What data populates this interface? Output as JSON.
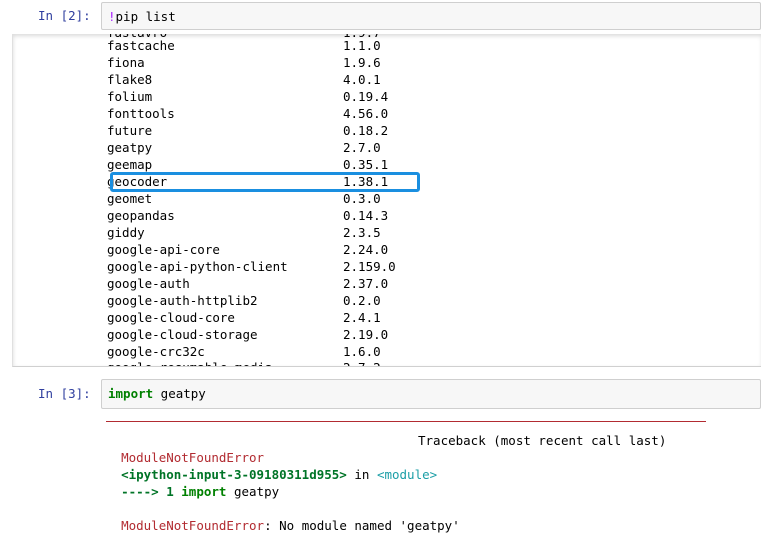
{
  "cell2": {
    "prompt": "In  [2]:",
    "bang": "!",
    "code": "pip list"
  },
  "packages": [
    {
      "name": "fastcache",
      "version": "1.1.0"
    },
    {
      "name": "fiona",
      "version": "1.9.6"
    },
    {
      "name": "flake8",
      "version": "4.0.1"
    },
    {
      "name": "folium",
      "version": "0.19.4"
    },
    {
      "name": "fonttools",
      "version": "4.56.0"
    },
    {
      "name": "future",
      "version": "0.18.2"
    },
    {
      "name": "geatpy",
      "version": "2.7.0"
    },
    {
      "name": "geemap",
      "version": "0.35.1"
    },
    {
      "name": "geocoder",
      "version": "1.38.1"
    },
    {
      "name": "geomet",
      "version": "0.3.0"
    },
    {
      "name": "geopandas",
      "version": "0.14.3"
    },
    {
      "name": "giddy",
      "version": "2.3.5"
    },
    {
      "name": "google-api-core",
      "version": "2.24.0"
    },
    {
      "name": "google-api-python-client",
      "version": "2.159.0"
    },
    {
      "name": "google-auth",
      "version": "2.37.0"
    },
    {
      "name": "google-auth-httplib2",
      "version": "0.2.0"
    },
    {
      "name": "google-cloud-core",
      "version": "2.4.1"
    },
    {
      "name": "google-cloud-storage",
      "version": "2.19.0"
    },
    {
      "name": "google-crc32c",
      "version": "1.6.0"
    }
  ],
  "cell3": {
    "prompt": "In  [3]:",
    "keyword": "import",
    "module": " geatpy"
  },
  "traceback": {
    "error_name": "ModuleNotFoundError",
    "header_right": "Traceback (most recent call last)",
    "input_ref": "<ipython-input-3-09180311d955>",
    "in_word": " in ",
    "module_ref": "<module>",
    "arrow_line": "----> 1 ",
    "arrow_kw": "import",
    "arrow_rest": " geatpy",
    "final_error": "ModuleNotFoundError",
    "final_msg": ": No module named 'geatpy'"
  },
  "colors": {
    "highlight_box": "#1a8fe0",
    "error_red": "#b22b31",
    "keyword_green": "#008000",
    "prompt_blue": "#303f9f"
  }
}
